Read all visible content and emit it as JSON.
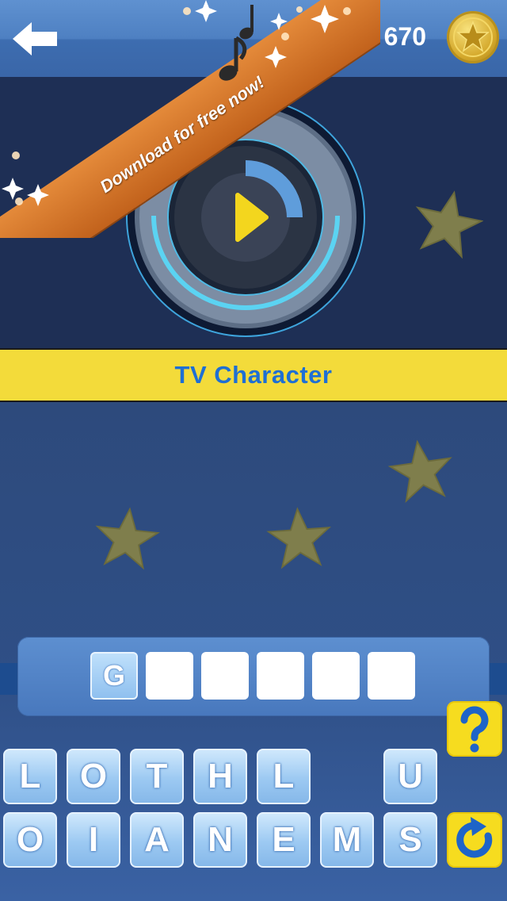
{
  "header": {
    "back_icon": "back-arrow-icon",
    "coins": "670",
    "coin_icon": "gold-star-coin-icon"
  },
  "promo": {
    "label": "Download for free now!"
  },
  "player": {
    "icon": "play-icon",
    "progress": 0.25
  },
  "category": {
    "label": "TV Character"
  },
  "answer": {
    "slots": [
      "G",
      "",
      "",
      "",
      "",
      ""
    ]
  },
  "keyboard": {
    "row1": [
      "L",
      "O",
      "T",
      "H",
      "L",
      "",
      "U"
    ],
    "row2": [
      "O",
      "I",
      "A",
      "N",
      "E",
      "M",
      "S"
    ]
  },
  "tools": {
    "hint_icon": "question-mark-icon",
    "reset_icon": "refresh-arrow-icon"
  },
  "colors": {
    "accent_yellow": "#f3db3a",
    "category_text": "#1e6fd4",
    "ribbon": "#d8772c"
  }
}
